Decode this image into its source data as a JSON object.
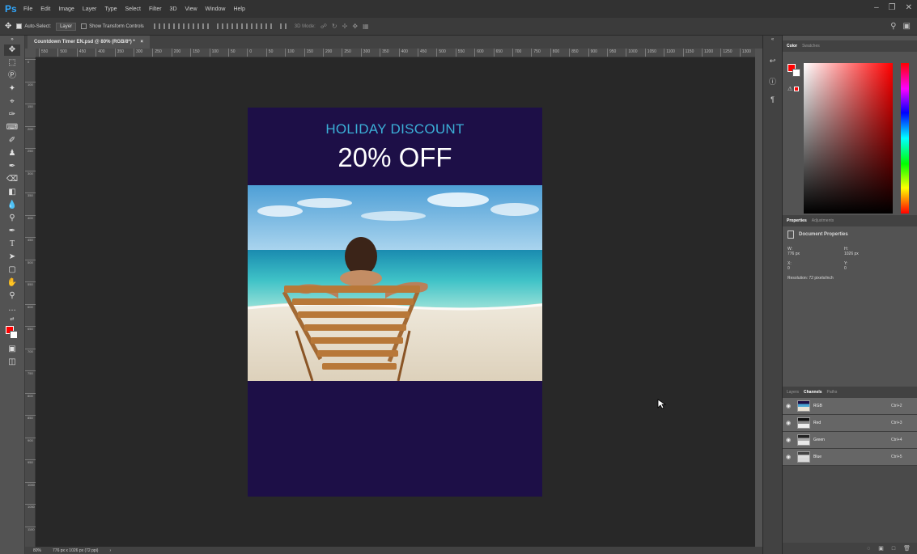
{
  "app": {
    "logo": "Ps"
  },
  "menu": [
    "File",
    "Edit",
    "Image",
    "Layer",
    "Type",
    "Select",
    "Filter",
    "3D",
    "View",
    "Window",
    "Help"
  ],
  "options_bar": {
    "auto_select_label": "Auto-Select:",
    "auto_select_value": "Layer",
    "show_transform_label": "Show Transform Controls",
    "mode_3d_label": "3D Mode:"
  },
  "document": {
    "tab_title": "Countdown Timer EN.psd @ 80% (RGB/8*) *",
    "tab_close": "×",
    "promo_title": "HOLIDAY DISCOUNT",
    "promo_discount": "20% OFF"
  },
  "ruler_top_labels": [
    "550",
    "500",
    "450",
    "400",
    "350",
    "300",
    "250",
    "200",
    "150",
    "100",
    "50",
    "0",
    "50",
    "100",
    "150",
    "200",
    "250",
    "300",
    "350",
    "400",
    "450",
    "500",
    "550",
    "600",
    "650",
    "700",
    "750",
    "800",
    "850",
    "900",
    "950",
    "1000",
    "1050",
    "1100",
    "1150",
    "1200",
    "1250",
    "1300"
  ],
  "ruler_left_labels": [
    "0",
    "100",
    "150",
    "200",
    "250",
    "300",
    "350",
    "400",
    "450",
    "500",
    "550",
    "600",
    "650",
    "700",
    "750",
    "800",
    "850",
    "900",
    "950",
    "1000",
    "1050",
    "1100"
  ],
  "status": {
    "zoom": "80%",
    "doc_info": "776 px x 1026 px (72 ppi)",
    "arrow": "›"
  },
  "color_panel": {
    "tabs": [
      "Color",
      "Swatches"
    ],
    "foreground": "#ff0000",
    "background": "#ffffff"
  },
  "properties_panel": {
    "tabs": [
      "Properties",
      "Adjustments"
    ],
    "header": "Document Properties",
    "w_label": "W:",
    "w_value": "776 px",
    "h_label": "H:",
    "h_value": "1026 px",
    "x_label": "X:",
    "x_value": "0",
    "y_label": "Y:",
    "y_value": "0",
    "resolution": "Resolution: 72 pixels/inch"
  },
  "channels_panel": {
    "tabs": [
      "Layers",
      "Channels",
      "Paths"
    ],
    "channels": [
      {
        "name": "RGB",
        "shortcut": "Ctrl+2"
      },
      {
        "name": "Red",
        "shortcut": "Ctrl+3"
      },
      {
        "name": "Green",
        "shortcut": "Ctrl+4"
      },
      {
        "name": "Blue",
        "shortcut": "Ctrl+5"
      }
    ]
  },
  "colors": {
    "canvas_bg": "#282828",
    "doc_bg": "#1d0f47",
    "promo_title": "#3bb0d8",
    "accent": "#31a8ff"
  }
}
